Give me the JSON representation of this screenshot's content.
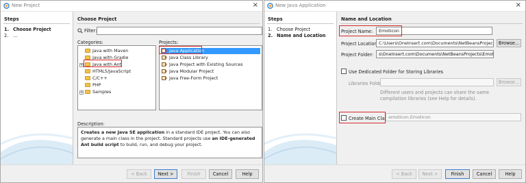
{
  "colors": {
    "selection": "#3399ff",
    "highlight_red": "#d6282b",
    "brand": "#f0c64a"
  },
  "left_window": {
    "title": "New Project",
    "steps_heading": "Steps",
    "steps": [
      {
        "num": "1.",
        "label": "Choose Project"
      },
      {
        "num": "2.",
        "label": "..."
      }
    ],
    "section_title": "Choose Project",
    "filter_label": "Filter:",
    "filter_value": "",
    "categories_label": "Categories:",
    "categories": [
      {
        "label": "Java with Maven",
        "icon": "folder-icon"
      },
      {
        "label": "Java with Gradle",
        "icon": "folder-icon"
      },
      {
        "label": "Java with Ant",
        "icon": "folder-icon",
        "expander": "+"
      },
      {
        "label": "HTML5/JavaScript",
        "icon": "folder-icon"
      },
      {
        "label": "C/C++",
        "icon": "folder-icon"
      },
      {
        "label": "PHP",
        "icon": "folder-icon"
      },
      {
        "label": "Samples",
        "icon": "folder-icon",
        "expander": "+"
      }
    ],
    "projects_label": "Projects:",
    "projects": [
      {
        "label": "Java Application",
        "icon": "java-coffee-icon",
        "selected": true
      },
      {
        "label": "Java Class Library",
        "icon": "java-coffee-icon"
      },
      {
        "label": "Java Project with Existing Sources",
        "icon": "java-coffee-icon"
      },
      {
        "label": "Java Modular Project",
        "icon": "java-coffee-icon"
      },
      {
        "label": "Java Free-Form Project",
        "icon": "java-coffee-icon"
      }
    ],
    "description_label": "Description:",
    "description": {
      "p1": "Creates a new Java SE application",
      "p2": " in a standard IDE project. You can also generate a main class in the project. Standard projects use ",
      "p3": "an IDE-generated Ant build script",
      "p4": " to build, run, and debug your project."
    },
    "buttons": {
      "back": "< Back",
      "next": "Next >",
      "finish": "Finish",
      "cancel": "Cancel",
      "help": "Help"
    }
  },
  "right_window": {
    "title": "New Java Application",
    "steps_heading": "Steps",
    "steps": [
      {
        "num": "1.",
        "label": "Choose Project"
      },
      {
        "num": "2.",
        "label": "Name and Location"
      }
    ],
    "section_title": "Name and Location",
    "project_name_label": "Project Name:",
    "project_name_value": "Emoticon",
    "project_location_label": "Project Location:",
    "project_location_value": "C:\\Users\\OneInsert.com\\Documents\\NetBeansProjects",
    "browse_label": "Browse...",
    "project_folder_label": "Project Folder:",
    "project_folder_value": "s\\OneInsert.com\\Documents\\NetBeansProjects\\Emoticon",
    "dedicated_folder_label": "Use Dedicated Folder for Storing Libraries",
    "libraries_folder_label": "Libraries Folder:",
    "libraries_folder_value": "",
    "libraries_browse_label": "Browse...",
    "libraries_note_1": "Different users and projects can share the same",
    "libraries_note_2": "compilation libraries (see Help for details).",
    "create_main_label": "Create Main Class",
    "main_class_value": "emoticon.Emoticon",
    "buttons": {
      "back": "< Back",
      "next": "Next >",
      "finish": "Finish",
      "cancel": "Cancel",
      "help": "Help"
    }
  }
}
